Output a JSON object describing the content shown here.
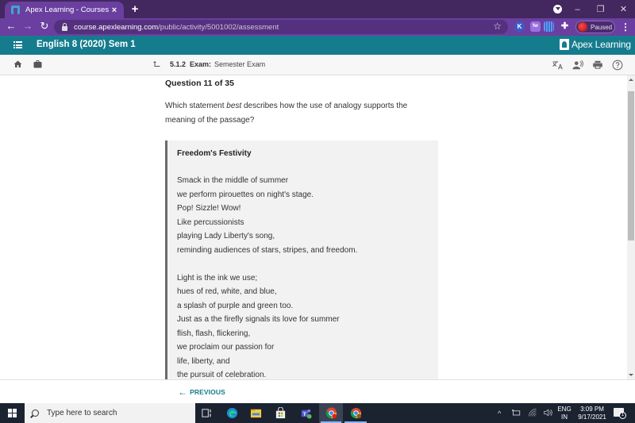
{
  "browser": {
    "tab": {
      "title": "Apex Learning - Courses",
      "close": "×"
    },
    "new_tab": "+",
    "window_controls": {
      "minimize": "–",
      "restore": "❐",
      "close": "✕"
    },
    "nav": {
      "back": "←",
      "forward": "→",
      "reload": "↻"
    },
    "url": {
      "host": "course.apexlearning.com",
      "path": "/public/activity/5001002/assessment"
    },
    "bookmark_star": "☆",
    "extensions": [
      "K",
      "fw",
      "grid",
      "puzzle"
    ],
    "profile": {
      "label": "Paused"
    },
    "menu": "⋮"
  },
  "header": {
    "course_title": "English 8 (2020) Sem 1",
    "brand": "Apex Learning"
  },
  "subnav": {
    "breadcrumb": {
      "number": "5.1.2",
      "label": "Exam:",
      "title": "Semester Exam"
    },
    "tools": [
      "translate-icon",
      "read-aloud-icon",
      "print-icon",
      "help-icon"
    ]
  },
  "question": {
    "header": "Question 11 of 35",
    "prompt_before": "Which statement ",
    "prompt_emphasis": "best",
    "prompt_after": " describes how the use of analogy supports the meaning of the passage?"
  },
  "passage": {
    "title": "Freedom's Festivity",
    "stanzas": [
      [
        "Smack in the middle of summer",
        "we perform pirouettes on night's stage.",
        "Pop! Sizzle! Wow!",
        "Like percussionists",
        "playing Lady Liberty's song,",
        "reminding audiences of stars, stripes, and freedom."
      ],
      [
        "Light is the ink we use;",
        "hues of red, white, and blue,",
        "a splash of purple and green too.",
        "Just as a the firefly signals its love for summer",
        "flish, flash, flickering,",
        "we proclaim our passion for",
        "life, liberty, and",
        "the pursuit of celebration."
      ]
    ]
  },
  "footer": {
    "previous_label": "PREVIOUS"
  },
  "taskbar": {
    "search_placeholder": "Type here to search",
    "language": {
      "line1": "ENG",
      "line2": "IN"
    },
    "time": "3:09 PM",
    "date": "9/17/2021",
    "notification_count": "1"
  },
  "colors": {
    "browser_frame": "#43275f",
    "browser_toolbar": "#6a3fa0",
    "apex_header": "#157c8e",
    "accent": "#157c8e",
    "taskbar": "#1b2331"
  }
}
